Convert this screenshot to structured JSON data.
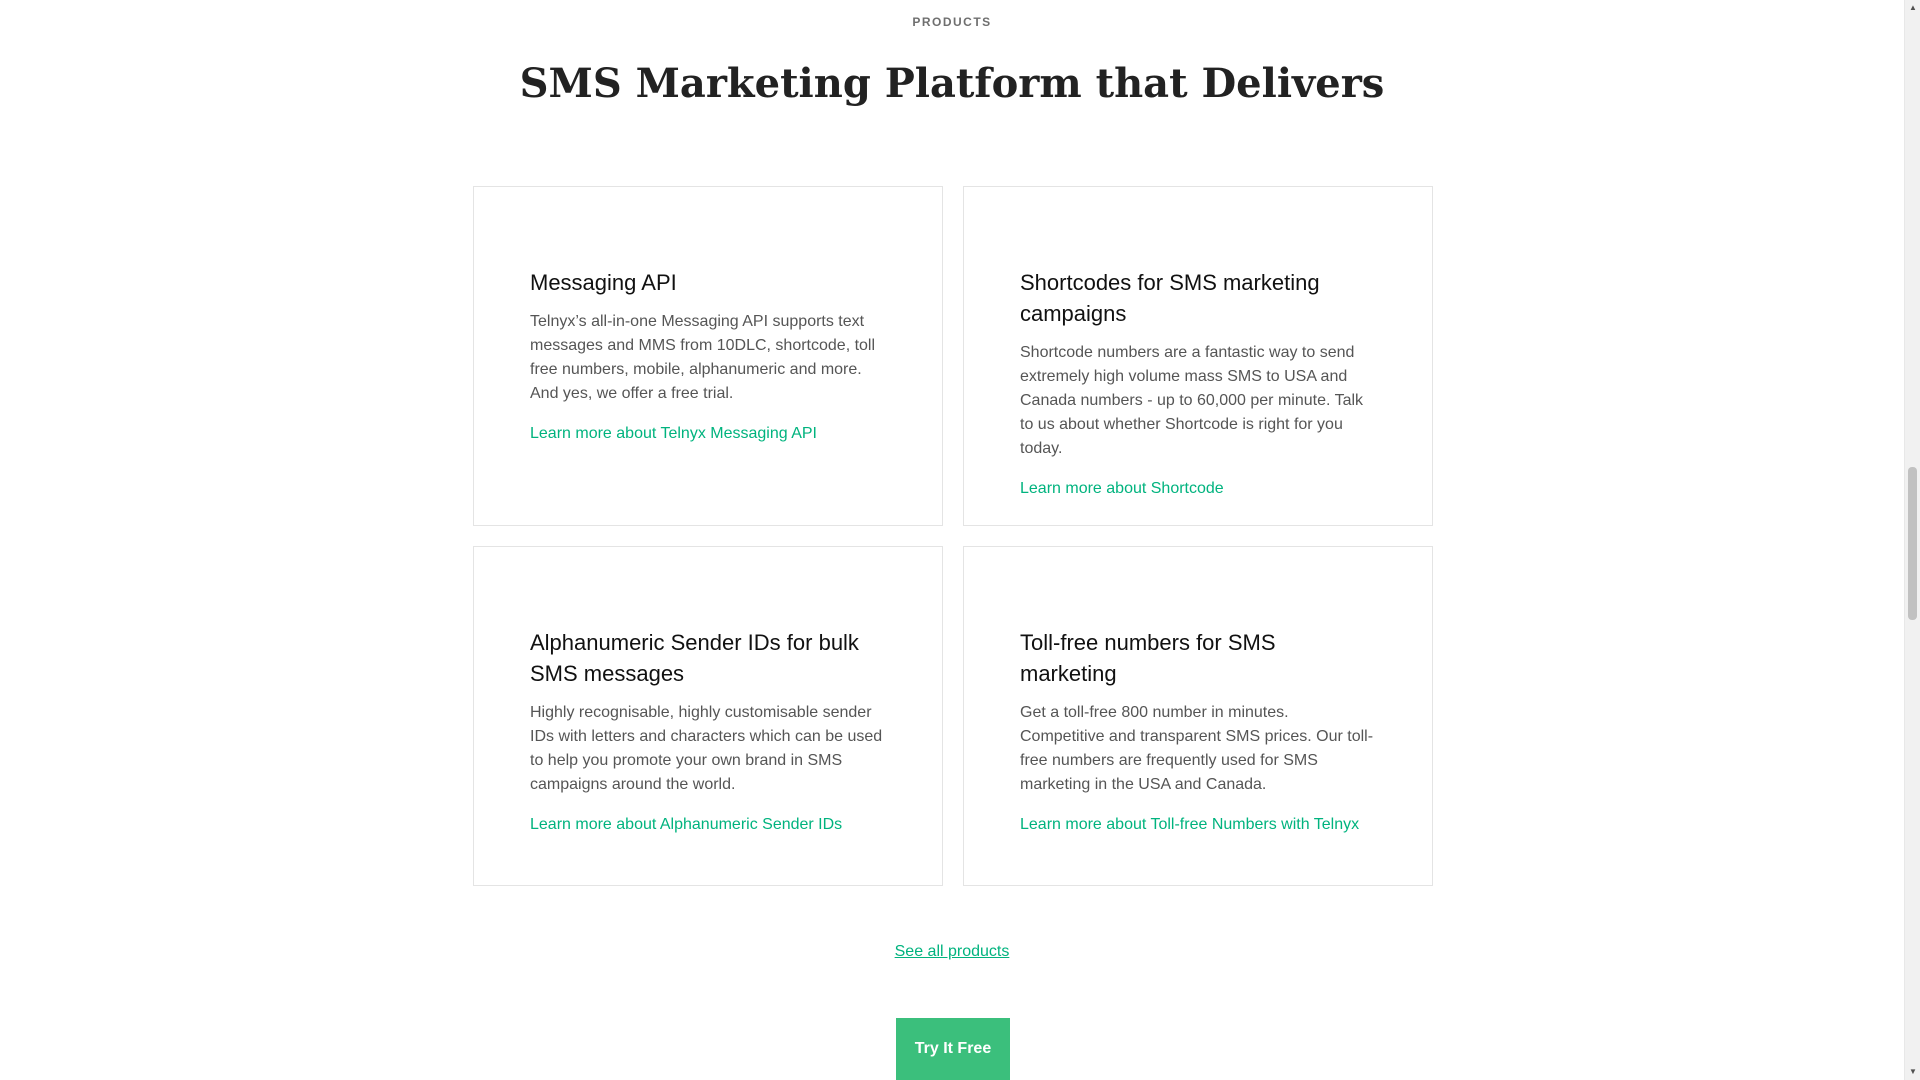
{
  "section": {
    "eyebrow": "PRODUCTS",
    "title": "SMS Marketing Platform that Delivers"
  },
  "cards": [
    {
      "title": "Messaging API",
      "description": "Telnyx’s all-in-one Messaging API supports text messages and MMS from 10DLC, shortcode, toll free numbers, mobile, alphanumeric and more. And yes, we offer a free trial.",
      "link": "Learn more about Telnyx Messaging API"
    },
    {
      "title": "Shortcodes for SMS marketing campaigns",
      "description": "Shortcode numbers are a fantastic way to send extremely high volume mass SMS to USA and Canada numbers - up to 60,000 per minute. Talk to us about whether Shortcode is right for you today.",
      "link": "Learn more about Shortcode"
    },
    {
      "title": "Alphanumeric Sender IDs for bulk SMS messages",
      "description": "Highly recognisable, highly customisable sender IDs with letters and characters which can be used to help you promote your own brand in SMS campaigns around the world.",
      "link": "Learn more about Alphanumeric Sender IDs"
    },
    {
      "title": "Toll-free numbers for SMS marketing",
      "description": "Get a toll-free 800 number in minutes. Competitive and transparent SMS prices. Our toll-free numbers are frequently used for SMS marketing in the USA and Canada.",
      "link": "Learn more about Toll-free Numbers with Telnyx"
    }
  ],
  "see_all": "See all products",
  "cta": "Try It Free",
  "scrollbar": {
    "up_icon": "triangle-up",
    "down_icon": "triangle-down"
  },
  "colors": {
    "accent": "#00b37e",
    "cta_bg": "#3bbf7c"
  }
}
